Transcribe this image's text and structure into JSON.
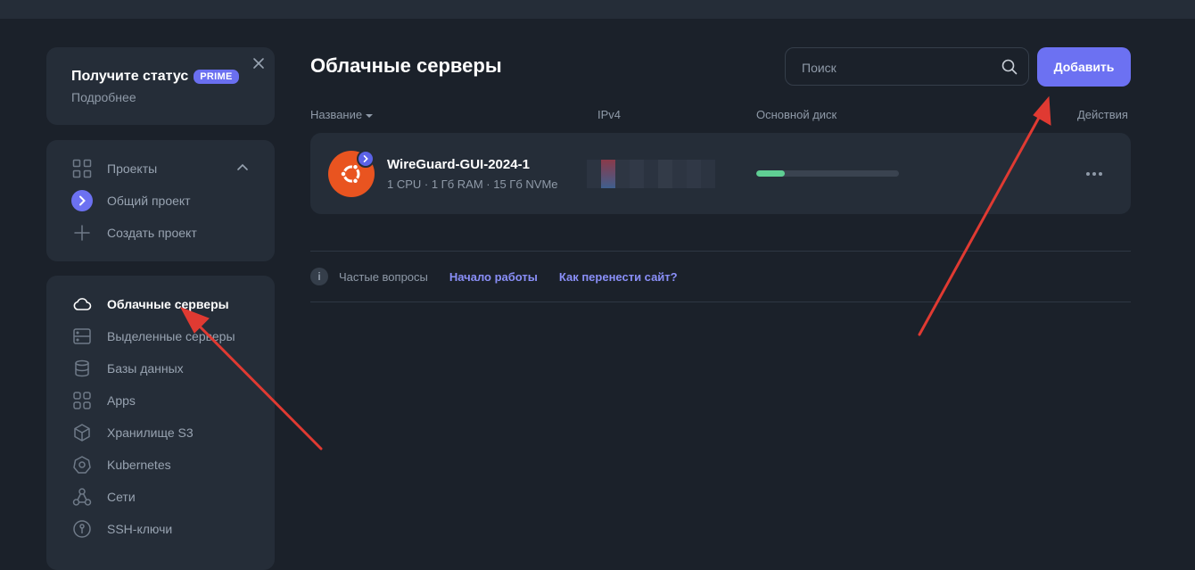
{
  "promo": {
    "title": "Получите статус",
    "badge": "PRIME",
    "link": "Подробнее"
  },
  "projects": {
    "header": "Проекты",
    "items": [
      {
        "label": "Общий проект",
        "icon": "chevron-right-icon"
      },
      {
        "label": "Создать проект",
        "icon": "plus-icon"
      }
    ]
  },
  "nav": {
    "items": [
      {
        "label": "Облачные серверы",
        "icon": "cloud-icon",
        "active": true
      },
      {
        "label": "Выделенные серверы",
        "icon": "server-icon"
      },
      {
        "label": "Базы данных",
        "icon": "database-icon"
      },
      {
        "label": "Apps",
        "icon": "apps-icon"
      },
      {
        "label": "Хранилище S3",
        "icon": "cube-icon"
      },
      {
        "label": "Kubernetes",
        "icon": "kubernetes-icon"
      },
      {
        "label": "Сети",
        "icon": "network-icon"
      },
      {
        "label": "SSH-ключи",
        "icon": "key-icon"
      }
    ]
  },
  "main": {
    "title": "Облачные серверы",
    "search_placeholder": "Поиск",
    "add_label": "Добавить",
    "columns": {
      "name": "Название",
      "ipv4": "IPv4",
      "disk": "Основной диск",
      "actions": "Действия"
    },
    "servers": [
      {
        "name": "WireGuard-GUI-2024-1",
        "specs": "1 CPU · 1 Гб RAM · 15 Гб NVMe",
        "os": "ubuntu-icon",
        "disk_usage": 0.2
      }
    ],
    "faq": {
      "label": "Частые вопросы",
      "links": [
        "Начало работы",
        "Как перенести сайт?"
      ]
    }
  },
  "colors": {
    "accent": "#6c71f2",
    "ubuntu": "#e95420",
    "disk": "#5fce93",
    "annotation": "#e03a32"
  }
}
